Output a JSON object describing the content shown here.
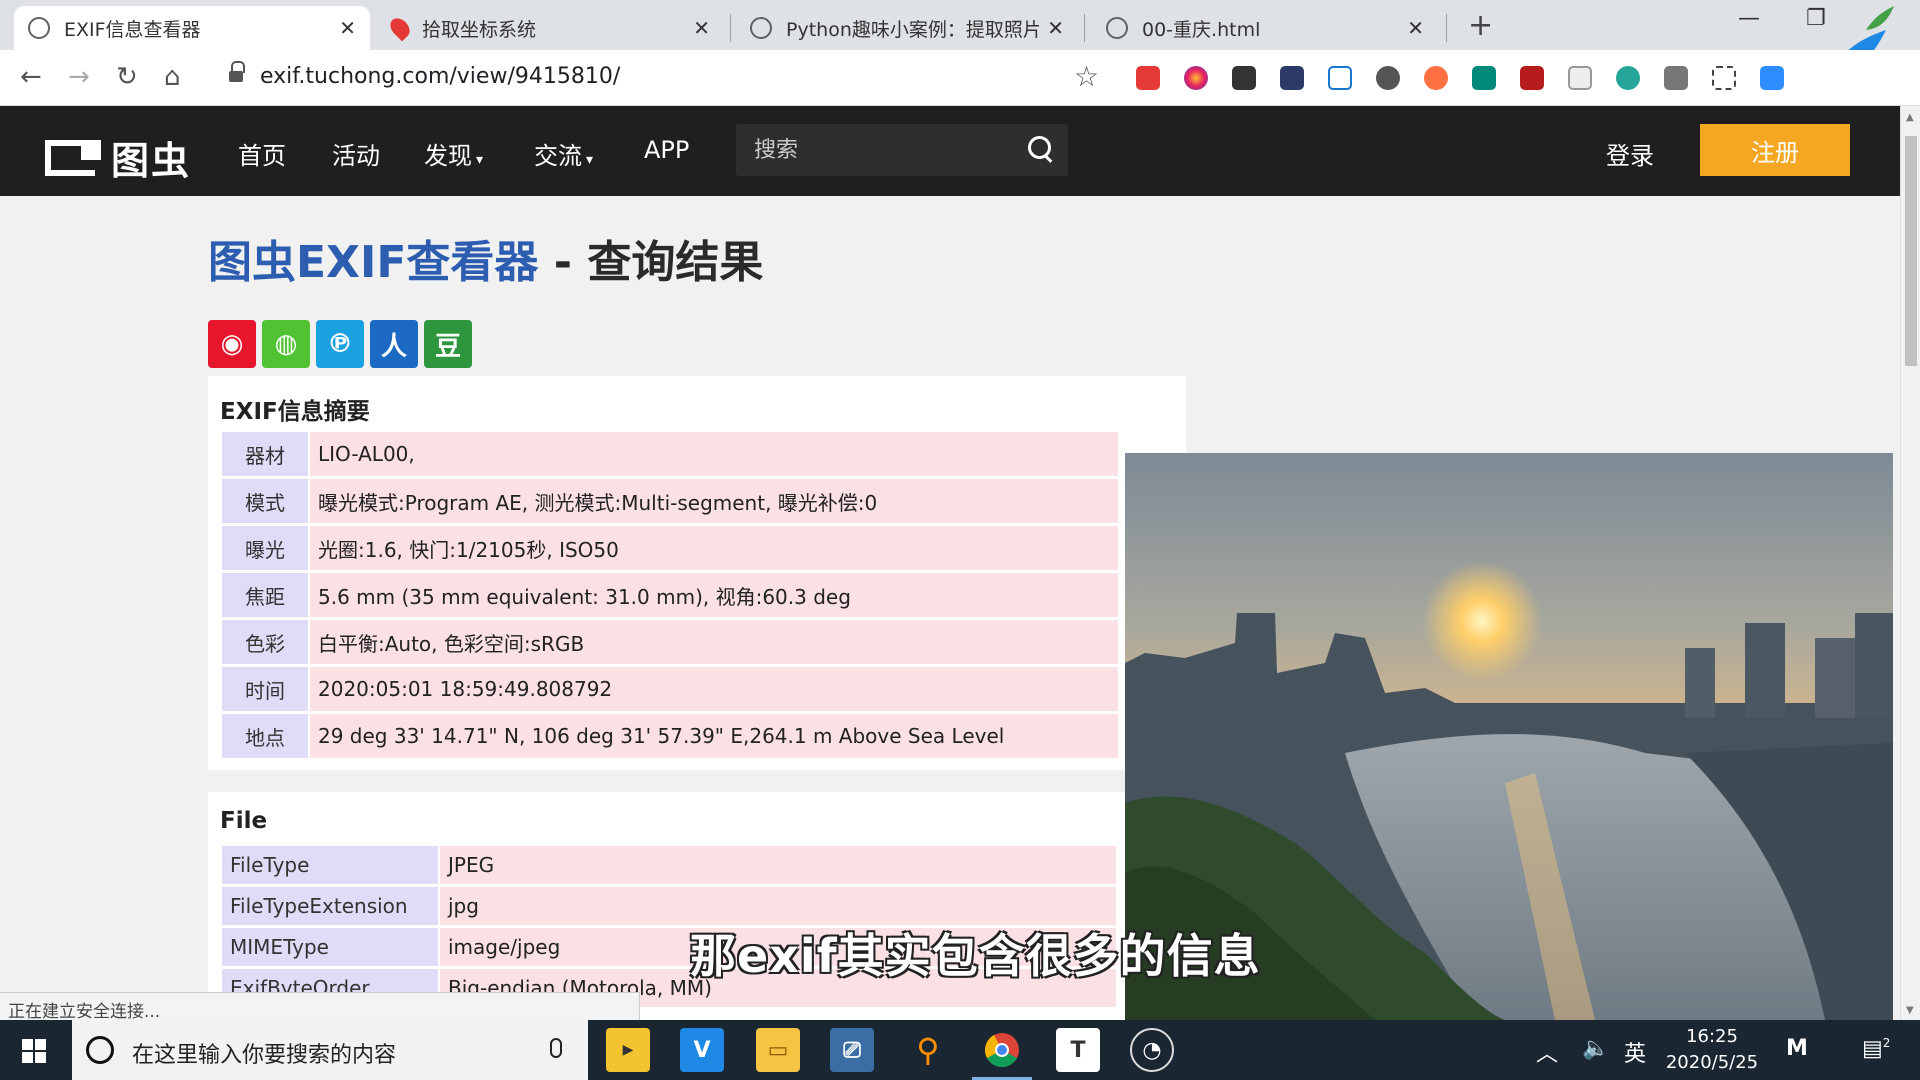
{
  "browser": {
    "tabs": [
      {
        "title": "EXIF信息查看器",
        "active": true
      },
      {
        "title": "拾取坐标系统",
        "active": false
      },
      {
        "title": "Python趣味小案例：提取照片EXIF",
        "active": false
      },
      {
        "title": "00-重庆.html",
        "active": false
      }
    ],
    "new_tab": "+",
    "url": "exif.tuchong.com/view/9415810/",
    "status_text": "正在建立安全连接..."
  },
  "site": {
    "logo_text": "图虫",
    "nav": [
      {
        "label": "首页",
        "dropdown": false
      },
      {
        "label": "活动",
        "dropdown": false
      },
      {
        "label": "发现",
        "dropdown": true
      },
      {
        "label": "交流",
        "dropdown": true
      },
      {
        "label": "APP",
        "dropdown": false
      }
    ],
    "search_placeholder": "搜索",
    "login_label": "登录",
    "register_label": "注册",
    "accent_color": "#f5a623"
  },
  "page": {
    "title_brand": "图虫EXIF查看器",
    "title_rest": " - 查询结果",
    "share_icons": [
      "weibo-icon",
      "wechat-icon",
      "qzone-icon",
      "renren-icon",
      "douban-icon"
    ],
    "summary": {
      "heading": "EXIF信息摘要",
      "rows": [
        {
          "key": "器材",
          "value": "LIO-AL00,"
        },
        {
          "key": "模式",
          "value": "曝光模式:Program AE, 测光模式:Multi-segment, 曝光补偿:0"
        },
        {
          "key": "曝光",
          "value": "光圈:1.6, 快门:1/2105秒, ISO50"
        },
        {
          "key": "焦距",
          "value": "5.6 mm (35 mm equivalent: 31.0 mm), 视角:60.3 deg"
        },
        {
          "key": "色彩",
          "value": "白平衡:Auto, 色彩空间:sRGB"
        },
        {
          "key": "时间",
          "value": "2020:05:01 18:59:49.808792"
        },
        {
          "key": "地点",
          "value": "29 deg 33' 14.71\" N, 106 deg 31' 57.39\" E,264.1 m Above Sea Level"
        }
      ]
    },
    "file": {
      "heading": "File",
      "rows": [
        {
          "key": "FileType",
          "value": "JPEG"
        },
        {
          "key": "FileTypeExtension",
          "value": "jpg"
        },
        {
          "key": "MIMEType",
          "value": "image/jpeg"
        },
        {
          "key": "ExifByteOrder",
          "value": "Big-endian (Motorola, MM)"
        }
      ]
    }
  },
  "video_subtitle": "那exif其实包含很多的信息",
  "taskbar": {
    "search_placeholder": "在这里输入你要搜索的内容",
    "ime": "英",
    "time": "16:25",
    "date": "2020/5/25",
    "notification_count": "2"
  }
}
